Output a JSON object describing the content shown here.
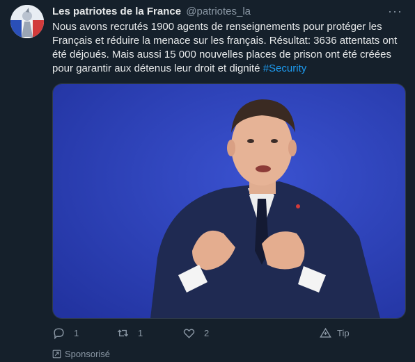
{
  "tweet": {
    "display_name": "Les patriotes de la France",
    "handle": "@patriotes_la",
    "text_before_hashtag": "Nous avons recrutés 1900  agents de renseignements pour protéger les Français et réduire la menace sur les français. Résultat: 3636 attentats ont été déjoués. Mais aussi 15 000 nouvelles places de prison ont été créées pour garantir aux détenus leur droit et dignité ",
    "hashtag": "#Security",
    "media_icon": "photo-of-speaker-gesturing"
  },
  "actions": {
    "reply_count": "1",
    "retweet_count": "1",
    "like_count": "2",
    "tip_label": "Tip"
  },
  "promo": {
    "label": "Sponsorisé"
  },
  "colors": {
    "background": "#15202b",
    "text": "#e7e9ea",
    "muted": "#8b98a5",
    "accent": "#1d9bf0",
    "photo_background": "#2e3fb0",
    "suit": "#1f2a52"
  }
}
